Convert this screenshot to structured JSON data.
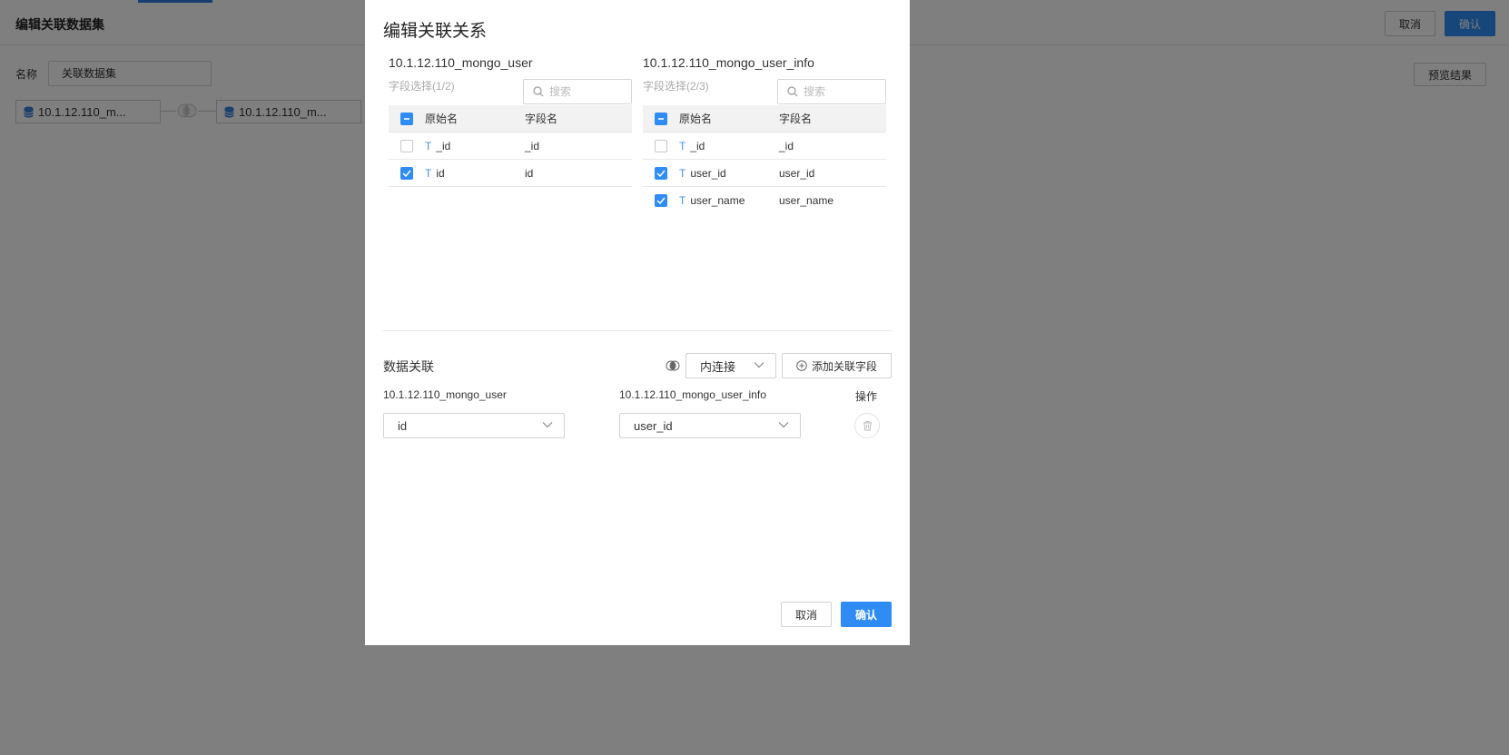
{
  "background": {
    "title": "编辑关联数据集",
    "cancel_label": "取消",
    "confirm_label": "确认",
    "name_label": "名称",
    "name_value": "关联数据集",
    "preview_label": "预览结果",
    "datasources": [
      "10.1.12.110_m...",
      "10.1.12.110_m..."
    ]
  },
  "dialog": {
    "title": "编辑关联关系",
    "left": {
      "name": "10.1.12.110_mongo_user",
      "field_count": "字段选择(1/2)",
      "search_placeholder": "搜索",
      "col_original": "原始名",
      "col_field": "字段名",
      "rows": [
        {
          "original": "_id",
          "field": "_id",
          "checked": false
        },
        {
          "original": "id",
          "field": "id",
          "checked": true
        }
      ]
    },
    "right": {
      "name": "10.1.12.110_mongo_user_info",
      "field_count": "字段选择(2/3)",
      "search_placeholder": "搜索",
      "col_original": "原始名",
      "col_field": "字段名",
      "rows": [
        {
          "original": "_id",
          "field": "_id",
          "checked": false
        },
        {
          "original": "user_id",
          "field": "user_id",
          "checked": true
        },
        {
          "original": "user_name",
          "field": "user_name",
          "checked": true
        }
      ]
    },
    "relation": {
      "section_title": "数据关联",
      "join_type": "内连接",
      "add_field_label": "添加关联字段",
      "left_label": "10.1.12.110_mongo_user",
      "right_label": "10.1.12.110_mongo_user_info",
      "ops_label": "操作",
      "left_value": "id",
      "right_value": "user_id"
    },
    "footer": {
      "cancel_label": "取消",
      "confirm_label": "确认"
    }
  },
  "colors": {
    "primary": "#2f8cf4",
    "overlay": "rgba(0,0,0,0.5)"
  }
}
